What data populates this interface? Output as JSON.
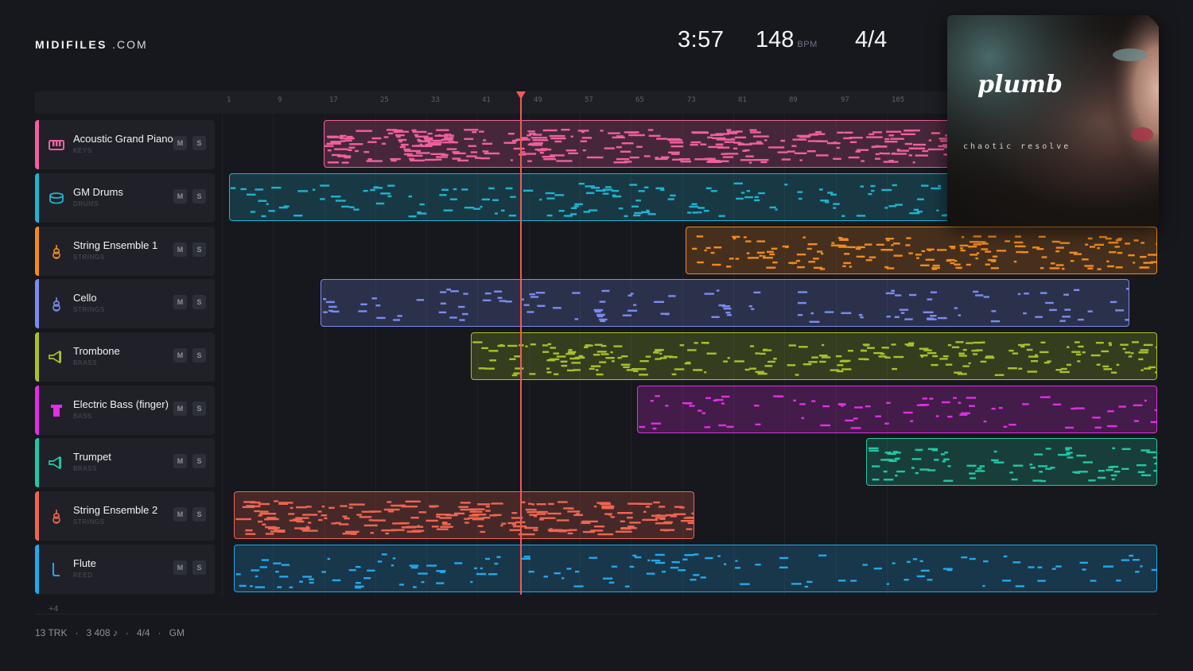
{
  "brand": {
    "bold": "MIDIFILES",
    "light": ".COM"
  },
  "transport": {
    "time": "3:57",
    "bpm": "148",
    "bpm_unit": "BPM",
    "time_signature": "4/4"
  },
  "ruler": {
    "bars": [
      "1",
      "9",
      "17",
      "25",
      "33",
      "41",
      "49",
      "57",
      "65",
      "73",
      "81",
      "89",
      "97",
      "105"
    ]
  },
  "album": {
    "artist": "plumb",
    "title": "chaotic resolve"
  },
  "tracks": [
    {
      "name": "Acoustic Grand Piano",
      "category": "KEYS",
      "color": "#f0609e",
      "icon": "piano-icon",
      "mute": "M",
      "solo": "S"
    },
    {
      "name": "GM Drums",
      "category": "DRUMS",
      "color": "#1fb3d0",
      "icon": "drum-icon",
      "mute": "M",
      "solo": "S"
    },
    {
      "name": "String Ensemble 1",
      "category": "STRINGS",
      "color": "#f28a1e",
      "icon": "violin-icon",
      "mute": "M",
      "solo": "S"
    },
    {
      "name": "Cello",
      "category": "STRINGS",
      "color": "#7a8cf0",
      "icon": "violin-icon",
      "mute": "M",
      "solo": "S"
    },
    {
      "name": "Trombone",
      "category": "BRASS",
      "color": "#a6c22a",
      "icon": "horn-icon",
      "mute": "M",
      "solo": "S"
    },
    {
      "name": "Electric Bass (finger)",
      "category": "BASS",
      "color": "#e22ee6",
      "icon": "bass-icon",
      "mute": "M",
      "solo": "S"
    },
    {
      "name": "Trumpet",
      "category": "BRASS",
      "color": "#20c8a4",
      "icon": "horn-icon",
      "mute": "M",
      "solo": "S"
    },
    {
      "name": "String Ensemble 2",
      "category": "STRINGS",
      "color": "#f06550",
      "icon": "violin-icon",
      "mute": "M",
      "solo": "S"
    },
    {
      "name": "Flute",
      "category": "REED",
      "color": "#22a8ee",
      "icon": "flute-icon",
      "mute": "M",
      "solo": "S"
    }
  ],
  "more_tracks": "+4",
  "footer": {
    "tracks": "13 TRK",
    "notes": "3 408 ♪",
    "signature": "4/4",
    "standard": "GM",
    "sep": "·"
  }
}
